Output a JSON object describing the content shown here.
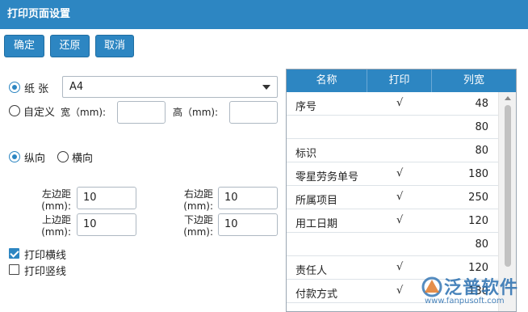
{
  "window": {
    "title": "打印页面设置"
  },
  "toolbar": {
    "ok": "确定",
    "restore": "还原",
    "cancel": "取消"
  },
  "paper": {
    "paper_label": "纸 张",
    "paper_value": "A4",
    "custom_label": "自定义",
    "width_label": "宽（mm):",
    "height_label": "高（mm):",
    "width_value": "",
    "height_value": "",
    "selected": "paper"
  },
  "orientation": {
    "portrait": "纵向",
    "landscape": "横向",
    "selected": "portrait"
  },
  "margins": {
    "left_label": "左边距\n(mm):",
    "right_label": "右边距\n(mm):",
    "top_label": "上边距\n(mm):",
    "bottom_label": "下边距\n(mm):",
    "left": "10",
    "right": "10",
    "top": "10",
    "bottom": "10"
  },
  "options": {
    "print_hlines": {
      "label": "打印横线",
      "checked": true
    },
    "print_vlines": {
      "label": "打印竖线",
      "checked": false
    }
  },
  "columns_table": {
    "headers": {
      "name": "名称",
      "print": "打印",
      "width": "列宽"
    },
    "rows": [
      {
        "name": "序号",
        "print": "√",
        "width": "48"
      },
      {
        "name": "",
        "print": "",
        "width": "80"
      },
      {
        "name": "标识",
        "print": "",
        "width": "80"
      },
      {
        "name": "零星劳务单号",
        "print": "√",
        "width": "180"
      },
      {
        "name": "所属项目",
        "print": "√",
        "width": "250"
      },
      {
        "name": "用工日期",
        "print": "√",
        "width": "120"
      },
      {
        "name": "",
        "print": "",
        "width": "80"
      },
      {
        "name": "责任人",
        "print": "√",
        "width": "120"
      },
      {
        "name": "付款方式",
        "print": "√",
        "width": "130"
      }
    ]
  },
  "watermark": {
    "brand": "泛普软件",
    "url": "www.fanpusoft.com"
  },
  "colors": {
    "accent": "#2d86c2",
    "border": "#aeb8c2"
  }
}
